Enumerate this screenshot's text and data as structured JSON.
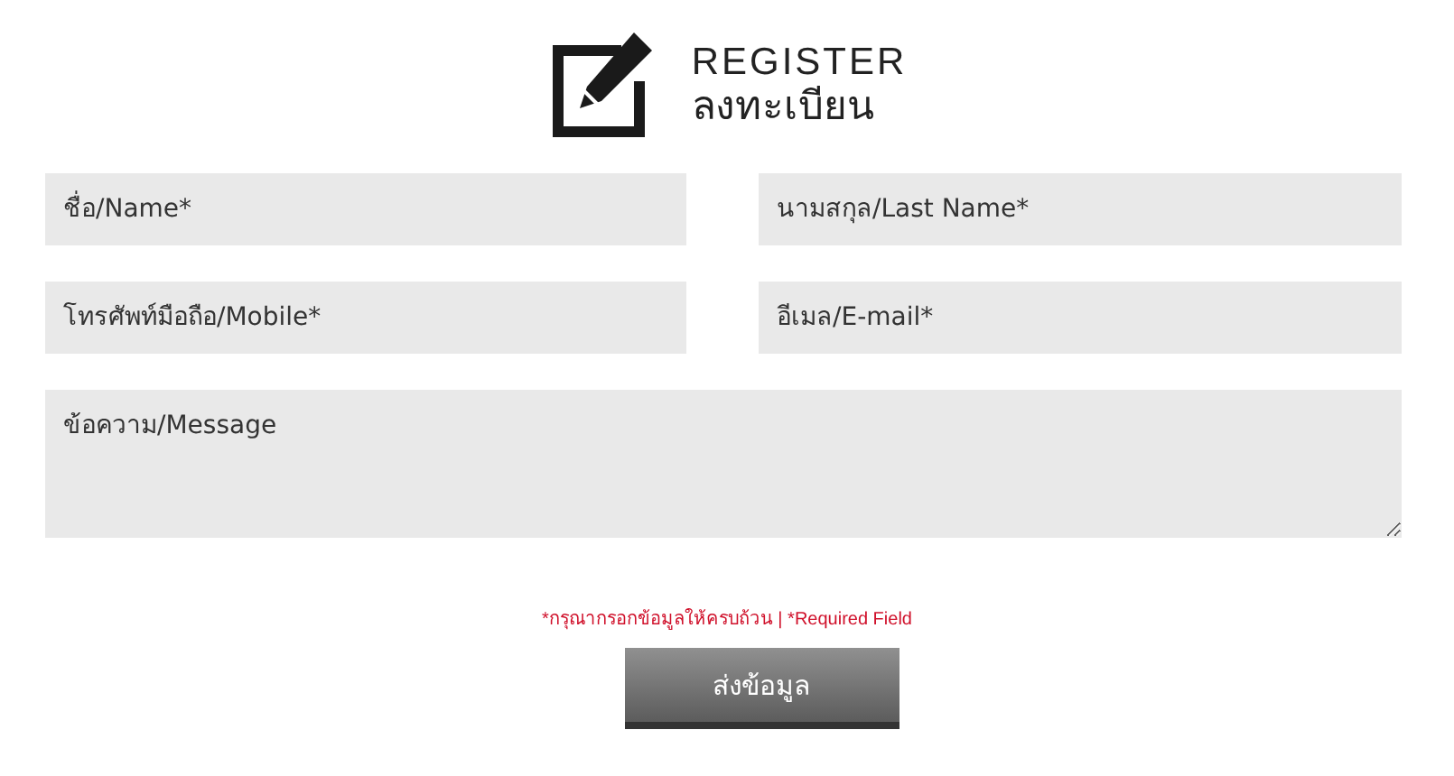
{
  "header": {
    "title": "REGISTER",
    "subtitle": "ลงทะเบียน"
  },
  "fields": [
    {
      "placeholder": "ชื่อ/Name*"
    },
    {
      "placeholder": "นามสกุล/Last Name*"
    },
    {
      "placeholder": "โทรศัพท์มือถือ/Mobile*"
    },
    {
      "placeholder": "อีเมล/E-mail*"
    }
  ],
  "message": {
    "placeholder": "ข้อความ/Message"
  },
  "note": "*กรุณากรอกข้อมูลให้ครบถ้วน | *Required Field",
  "submit": {
    "label": "ส่งข้อมูล"
  }
}
